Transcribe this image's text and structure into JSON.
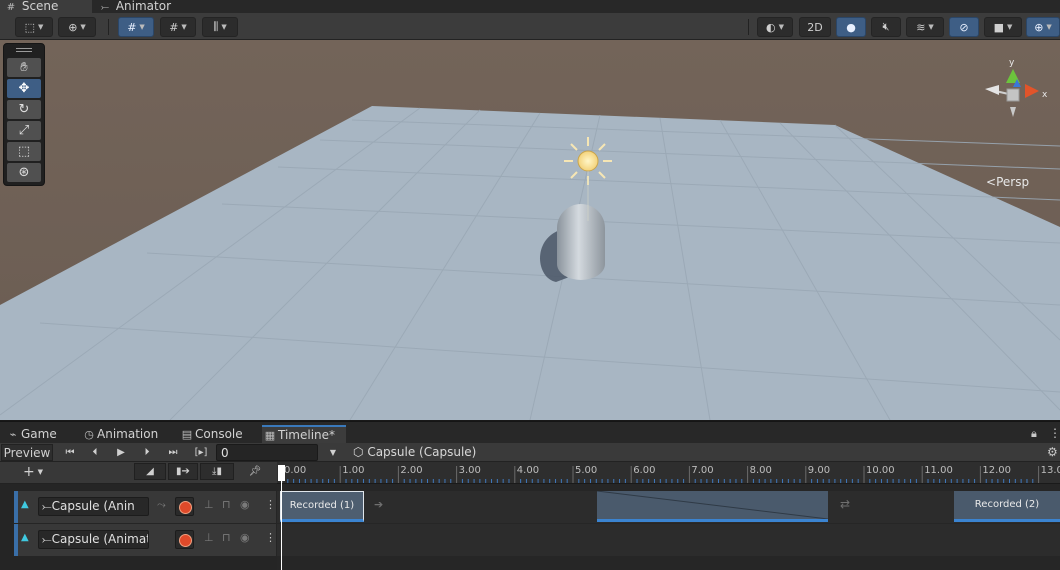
{
  "top_tabs": [
    {
      "label": "Scene",
      "icon": "grid-icon",
      "active": true
    },
    {
      "label": "Animator",
      "icon": "animator-icon",
      "active": false
    }
  ],
  "scene_toolbar": {
    "mode_2d_label": "2D"
  },
  "scene_view": {
    "projection_label": "Persp",
    "gizmo_axis_x": "x",
    "gizmo_axis_y": "y",
    "colors": {
      "ground": "#a9b7c4",
      "background": "#6f6056",
      "selection": "#3e5e85"
    }
  },
  "tools": [
    "hand-tool",
    "move-tool",
    "rotate-tool",
    "scale-tool",
    "rect-tool",
    "transform-tool"
  ],
  "bottom_tabs": [
    {
      "label": "Game",
      "icon": "gamepad-icon"
    },
    {
      "label": "Animation",
      "icon": "clock-icon"
    },
    {
      "label": "Console",
      "icon": "console-icon"
    },
    {
      "label": "Timeline*",
      "icon": "film-icon"
    }
  ],
  "timeline": {
    "preview_label": "Preview",
    "frame_value": "0",
    "breadcrumb": "Capsule (Capsule)",
    "frame_bracket": "[▸]",
    "ruler_ticks": [
      "0.00",
      "1.00",
      "2.00",
      "3.00",
      "4.00",
      "5.00",
      "6.00",
      "7.00",
      "8.00",
      "9.00",
      "10.00",
      "11.00",
      "12.00",
      "13.0"
    ],
    "tracks": [
      {
        "binding": "Capsule (Anin"
      },
      {
        "binding": "Capsule (Animatc"
      }
    ],
    "clips": [
      {
        "label": "Recorded (1)"
      },
      {
        "label": "Recorded (2)"
      }
    ]
  }
}
